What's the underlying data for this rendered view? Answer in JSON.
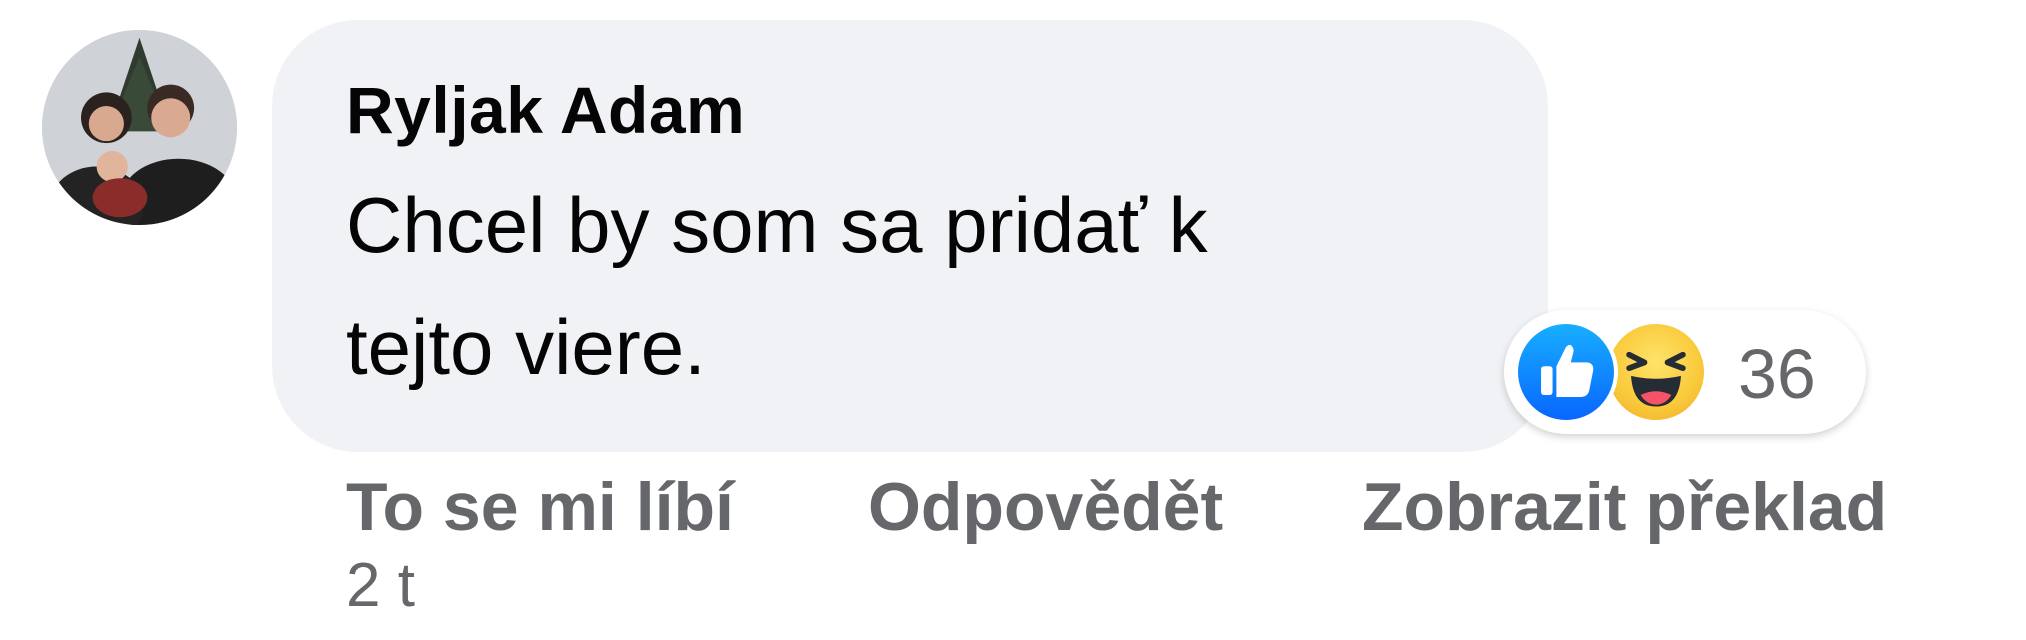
{
  "comment": {
    "avatar": {
      "icon": "profile-photo"
    },
    "author": "Ryljak Adam",
    "text_lines": [
      "Chcel by som sa pridať k",
      "tejto viere."
    ],
    "bubble_color": "#f0f2f5"
  },
  "reactions": {
    "types": [
      "like-reaction-icon",
      "haha-reaction-icon"
    ],
    "count": "36"
  },
  "actions": {
    "like_label": "To se mi líbí",
    "reply_label": "Odpovědět",
    "translate_label": "Zobrazit překlad"
  },
  "timestamp": "2 t",
  "colors": {
    "secondary_text": "#65676b",
    "primary_text": "#050505",
    "like_blue": "#0866ff",
    "haha_yellow": "#f9c93a"
  }
}
